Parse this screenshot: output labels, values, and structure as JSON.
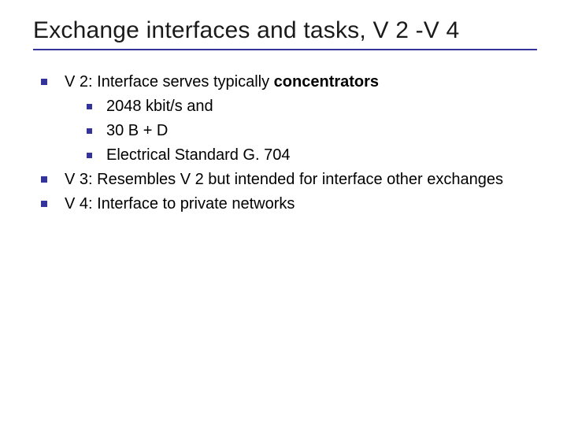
{
  "slide": {
    "title": "Exchange interfaces and tasks, V 2 -V 4",
    "items": [
      {
        "prefix": "V 2: Interface serves typically ",
        "bold": "concentrators",
        "sub": [
          "2048 kbit/s and",
          "30 B + D",
          "Electrical Standard G. 704"
        ]
      },
      {
        "text": "V 3: Resembles V 2 but intended for interface other exchanges"
      },
      {
        "text": "V 4: Interface to private networks"
      }
    ]
  }
}
